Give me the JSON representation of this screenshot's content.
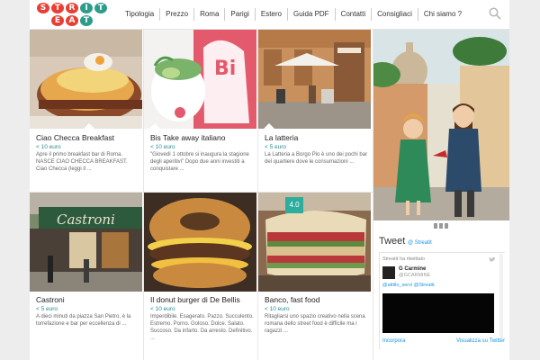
{
  "logo": {
    "top": [
      "S",
      "T",
      "R",
      "I",
      "T"
    ],
    "bottom": [
      "E",
      "A",
      "T"
    ],
    "top_colors": [
      "#e83e33",
      "#e83e33",
      "#e83e33",
      "#2e9c8a",
      "#2e9c8a"
    ],
    "bottom_colors": [
      "#e83e33",
      "#e83e33",
      "#2e9c8a"
    ]
  },
  "nav": {
    "items": [
      "Tipologia",
      "Prezzo",
      "Roma",
      "Parigi",
      "Estero",
      "Guida PDF",
      "Contatti",
      "Consigliaci",
      "Chi siamo ?"
    ]
  },
  "cards": [
    {
      "title": "Ciao Checca Breakfast",
      "price": "< 10 euro",
      "desc": "Apre il primo breakfast bar di Roma. NASCE CIAO CHECCA BREAKFAST. Ciao Checca (leggi il ..."
    },
    {
      "title": "Bis Take away italiano",
      "price": "< 10 euro",
      "desc": "\"Giovedì 1 ottobre si inaugura la stagione degli aperitivi\" Dopo due anni investiti a conquistare ..."
    },
    {
      "title": "La latteria",
      "price": "< 5 euro",
      "desc": "La Latteria a Borgo Pio è uno dei pochi bar del quartiere dove le consumazioni ..."
    },
    {
      "title": "Castroni",
      "price": "< 5 euro",
      "desc": "A dieci minuti da piazza San Pietro, è la torrefazione e bar per eccellenza di ..."
    },
    {
      "title": "Il donut burger di De Bellis",
      "price": "< 10 euro",
      "desc": "Imperdibile. Esagerato. Pazzo. Succulento. Estremo. Porno. Goloso. Dolce. Salato. Succoso. Da infarto. Da arresto. Definitivo. ..."
    },
    {
      "title": "Banco, fast food",
      "price": "< 10 euro",
      "desc": "Ritagliarsi uno spazio creativo nella scena romana dello street food è difficile ma i ragazzi ..."
    }
  ],
  "rating": "4.0",
  "twitter": {
    "header": "Tweet",
    "handle": "@ Streatit",
    "retweet_line": "Streatit ha ritwittato",
    "user_name": "G Carmine",
    "user_handle": "@GCARMINE",
    "tweet_text": "@attilio_servi @Streatit",
    "footer_left": "Incorpora",
    "footer_right": "Visualizza su Twitter"
  },
  "colors": {
    "accent": "#2a8a8f",
    "brand_red": "#e83e33",
    "brand_teal": "#2e9c8a",
    "twitter_blue": "#1b95e0"
  }
}
